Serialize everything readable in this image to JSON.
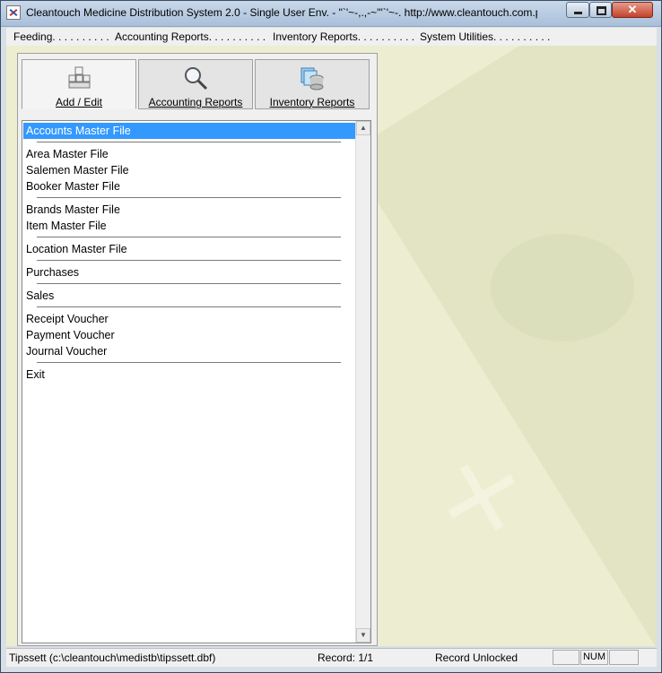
{
  "window": {
    "title": "Cleantouch Medicine Distribution System 2.0 - Single User Env.  -  \"`'~-,.,-~'\"`'~-. http://www.cleantouch.com.pk ,,.-~'\""
  },
  "menu": {
    "items": [
      {
        "label": "Feeding. . . . . . . . . ."
      },
      {
        "label": "Accounting Reports. . . . . . . . . ."
      },
      {
        "label": "Inventory Reports. . . . . . . . . ."
      },
      {
        "label": "System Utilities. . . . . . . . . ."
      }
    ]
  },
  "tabs": [
    {
      "label": "Add / Edit",
      "icon": "keyboard-icon"
    },
    {
      "label": "Accounting Reports",
      "icon": "magnifier-icon"
    },
    {
      "label": "Inventory Reports",
      "icon": "database-icon"
    }
  ],
  "list": {
    "items": [
      "Accounts Master File",
      "Area Master File",
      "Salemen Master File",
      "Booker Master File",
      "Brands Master File",
      "Item Master File",
      "Location Master File",
      "Purchases",
      "Sales",
      "Receipt Voucher",
      "Payment Voucher",
      "Journal Voucher",
      "Exit"
    ],
    "selected": "Accounts Master File"
  },
  "status": {
    "file": "Tipssett (c:\\cleantouch\\medistb\\tipssett.dbf)",
    "record": "Record: 1/1",
    "lock": "Record Unlocked",
    "num": "NUM"
  },
  "colors": {
    "selection": "#3399ff",
    "client_bg": "#ededd2"
  }
}
